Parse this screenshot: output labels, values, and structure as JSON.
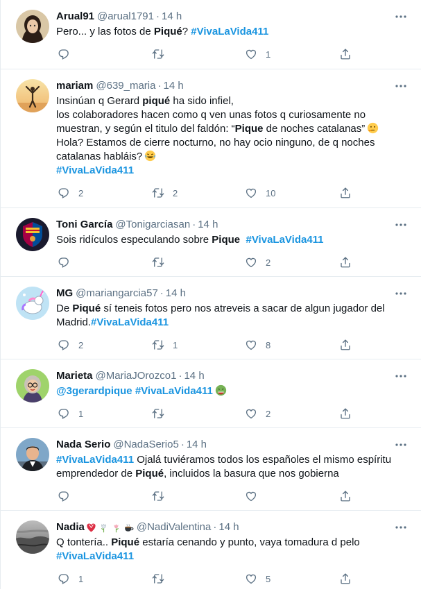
{
  "tweets": [
    {
      "name": "Arual91",
      "handle": "@arual1791",
      "time": "14 h",
      "reply_count": "",
      "retweet_count": "",
      "like_count": "1",
      "text": {
        "t1": "Pero... y las fotos de ",
        "b1": "Piqué",
        "t2": "? ",
        "tag": "#VivaLaVida411"
      }
    },
    {
      "name": "mariam",
      "handle": "@639_maria",
      "time": "14 h",
      "reply_count": "2",
      "retweet_count": "2",
      "like_count": "10",
      "text": {
        "t1": "Insinúan q Gerard ",
        "b1": "piqué",
        "t2": " ha sido infiel,",
        "l2": "los colaboradores hacen como q ven unas fotos q curiosamente no",
        "l3a": "muestran, y según el titulo del faldón: “",
        "b2": "Pique",
        "l3b": " de noches catalanas”",
        "l4": "Hola? Estamos de cierre nocturno, no hay ocio ninguno, de q noches",
        "l5": "catalanas habláis?",
        "tag": "#VivaLaVida411"
      }
    },
    {
      "name": "Toni García",
      "handle": "@Tonigarciasan",
      "time": "14 h",
      "reply_count": "",
      "retweet_count": "",
      "like_count": "2",
      "text": {
        "t1": "Sois ridículos especulando sobre ",
        "b1": "Pique",
        "tag": "#VivaLaVida411"
      }
    },
    {
      "name": "MG",
      "handle": "@mariangarcia57",
      "time": "14 h",
      "reply_count": "2",
      "retweet_count": "1",
      "like_count": "8",
      "text": {
        "t1": "De ",
        "b1": "Piqué",
        "t2": " sí teneis fotos pero nos atreveis a sacar de algun jugador del",
        "l2": "Madrid.",
        "tag": "#VivaLaVida411"
      }
    },
    {
      "name": "Marieta",
      "handle": "@MariaJOrozco1",
      "time": "14 h",
      "reply_count": "1",
      "retweet_count": "",
      "like_count": "2",
      "text": {
        "mention": "@3gerardpique",
        "tag": "#VivaLaVida411"
      }
    },
    {
      "name": "Nada Serio",
      "handle": "@NadaSerio5",
      "time": "14 h",
      "reply_count": "",
      "retweet_count": "",
      "like_count": "",
      "text": {
        "tag": "#VivaLaVida411",
        "t1": " Ojalá tuviéramos todos los españoles el mismo espíritu",
        "l2a": "emprendedor de ",
        "b1": "Piqué",
        "l2b": ", incluidos la basura que nos gobierna"
      }
    },
    {
      "name": "Nadia",
      "handle": "@NadiValentina",
      "time": "14 h",
      "reply_count": "1",
      "retweet_count": "",
      "like_count": "5",
      "text": {
        "t1": "Q tontería.. ",
        "b1": "Piqué",
        "t2": " estaría cenando y punto, vaya tomadura d pelo",
        "tag": "#VivaLaVida411"
      }
    }
  ],
  "colors": {
    "link": "#1b95e0",
    "muted": "#5b7083",
    "text": "#0f1419",
    "divider": "#e6ecf0"
  }
}
